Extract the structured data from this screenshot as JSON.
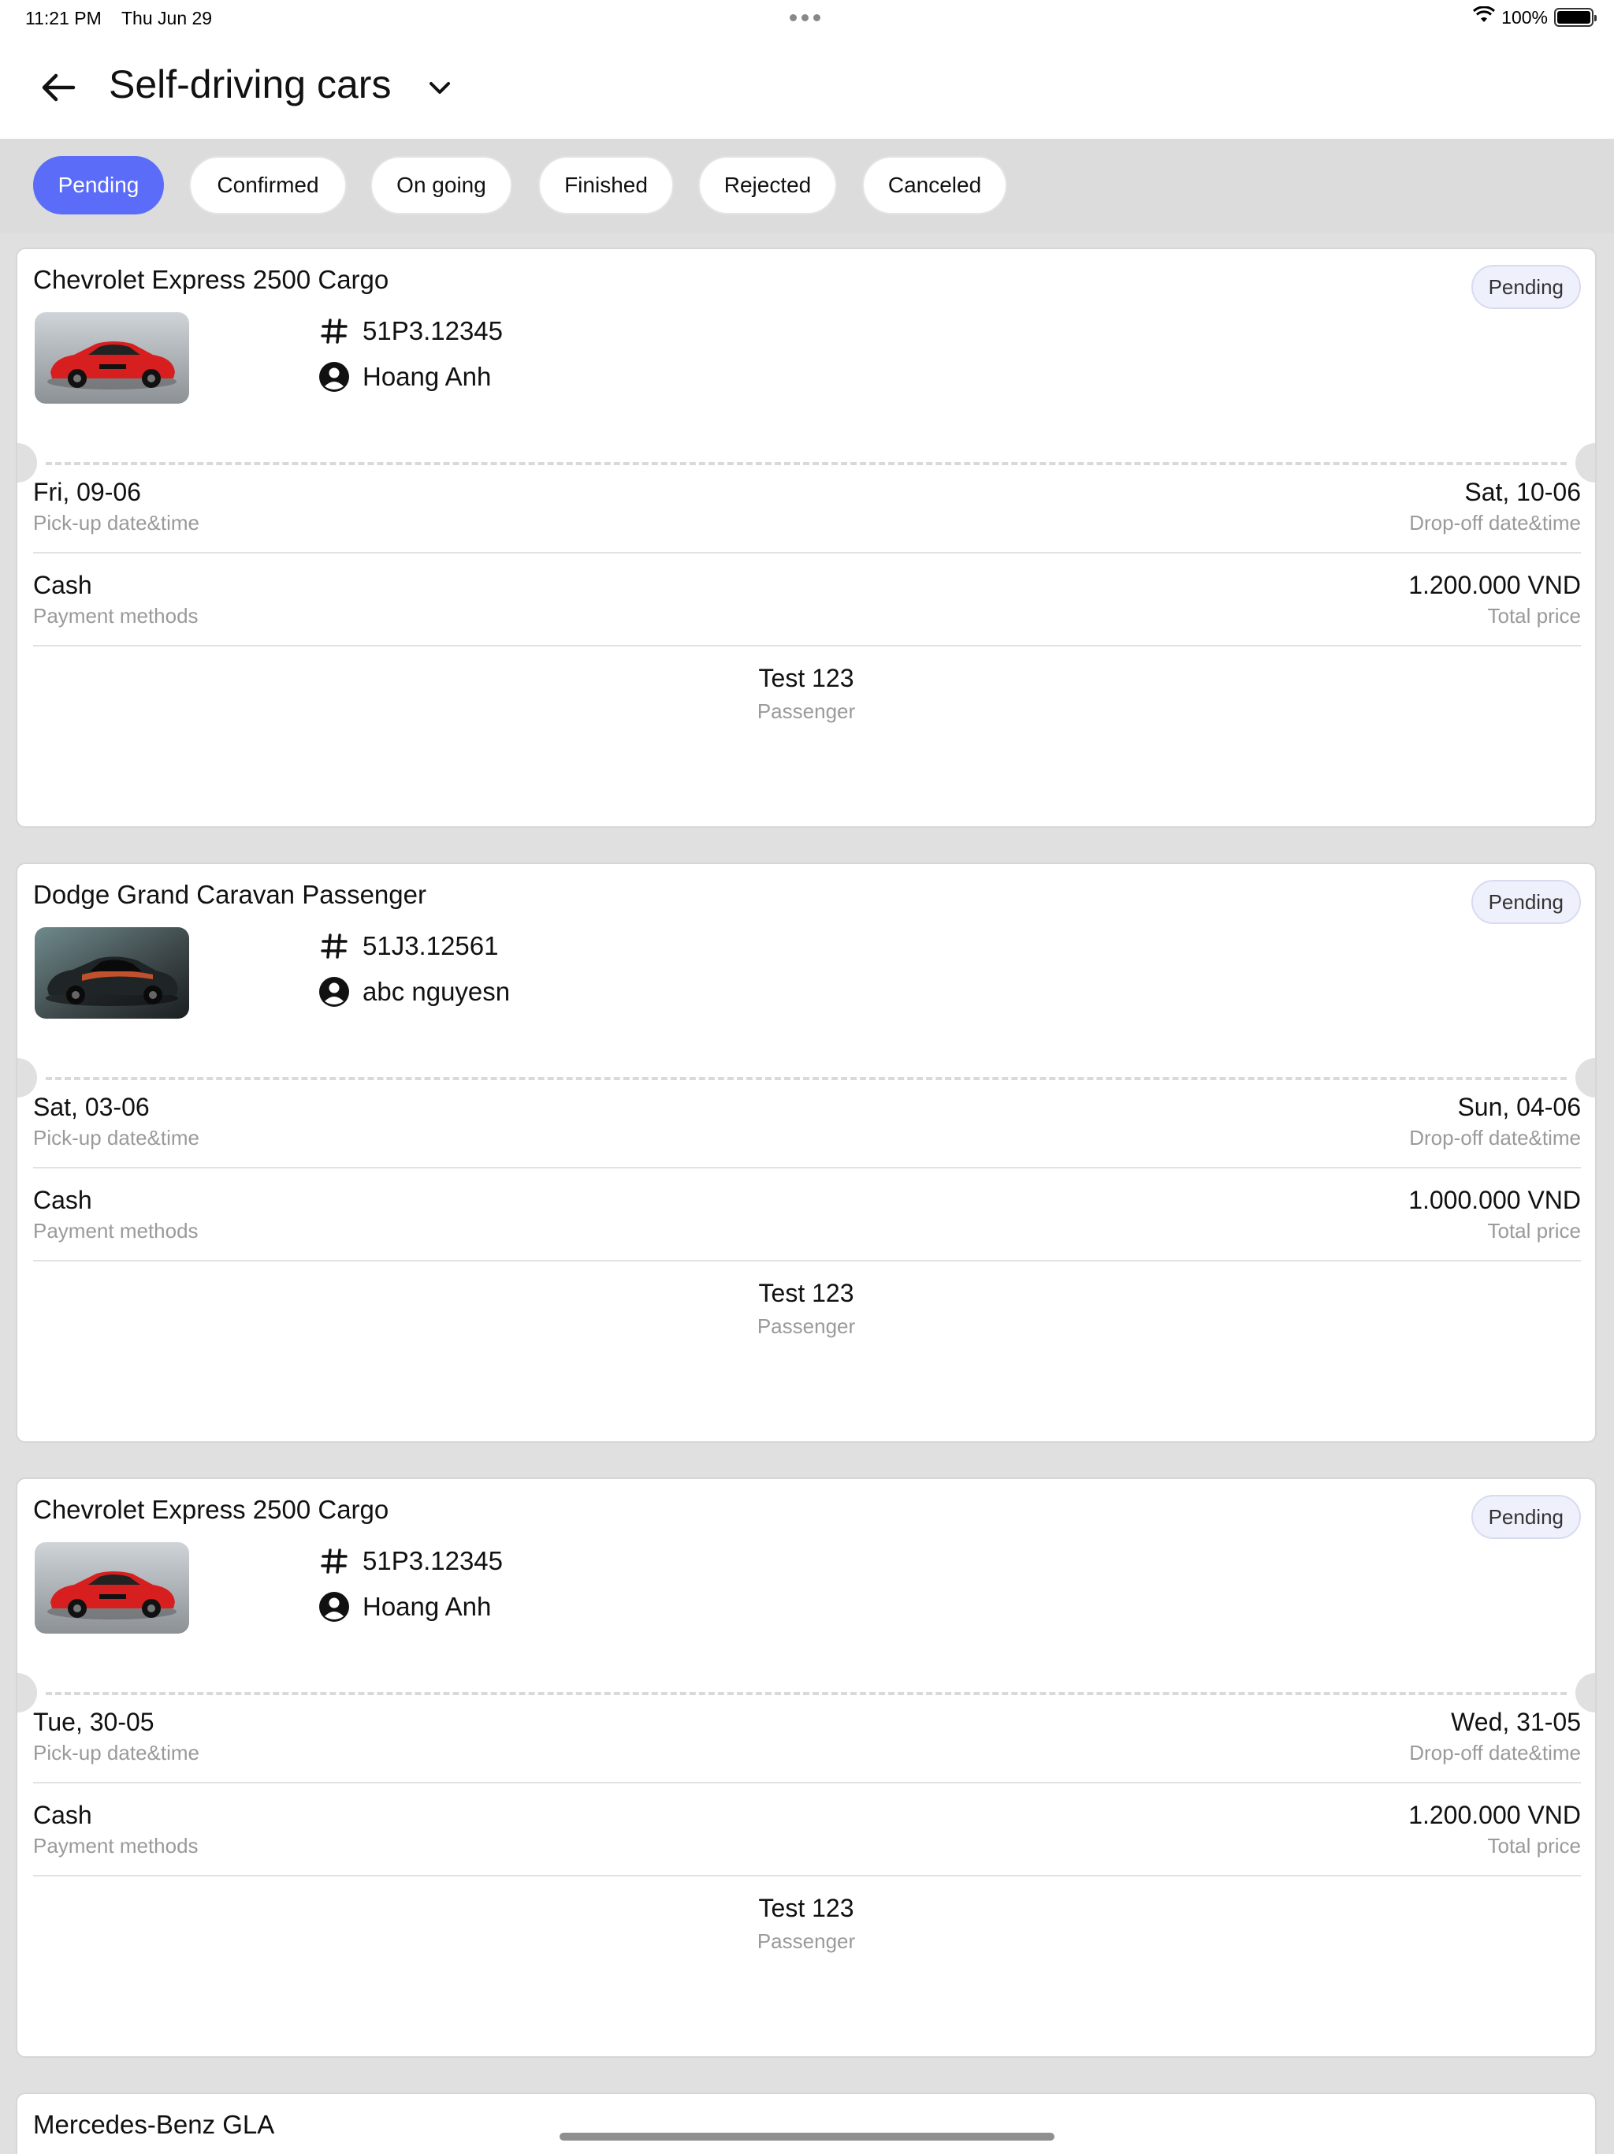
{
  "status_bar": {
    "time": "11:21 PM",
    "date": "Thu Jun 29",
    "battery": "100%"
  },
  "header": {
    "title": "Self-driving cars"
  },
  "tabs": [
    {
      "label": "Pending",
      "active": true
    },
    {
      "label": "Confirmed",
      "active": false
    },
    {
      "label": "On going",
      "active": false
    },
    {
      "label": "Finished",
      "active": false
    },
    {
      "label": "Rejected",
      "active": false
    },
    {
      "label": "Canceled",
      "active": false
    }
  ],
  "labels": {
    "pickup": "Pick-up date&time",
    "dropoff": "Drop-off date&time",
    "payment": "Payment methods",
    "total": "Total price",
    "passenger": "Passenger"
  },
  "bookings": [
    {
      "car_name": "Chevrolet Express 2500 Cargo",
      "status": "Pending",
      "plate": "51P3.12345",
      "owner": "Hoang Anh",
      "pickup_date": "Fri, 09-06",
      "dropoff_date": "Sat, 10-06",
      "payment_method": "Cash",
      "total_price": "1.200.000 VND",
      "passenger": "Test 123",
      "car_color": "red"
    },
    {
      "car_name": "Dodge Grand Caravan Passenger",
      "status": "Pending",
      "plate": "51J3.12561",
      "owner": "abc nguyesn",
      "pickup_date": "Sat, 03-06",
      "dropoff_date": "Sun, 04-06",
      "payment_method": "Cash",
      "total_price": "1.000.000 VND",
      "passenger": "Test 123",
      "car_color": "dark"
    },
    {
      "car_name": "Chevrolet Express 2500 Cargo",
      "status": "Pending",
      "plate": "51P3.12345",
      "owner": "Hoang Anh",
      "pickup_date": "Tue, 30-05",
      "dropoff_date": "Wed, 31-05",
      "payment_method": "Cash",
      "total_price": "1.200.000 VND",
      "passenger": "Test 123",
      "car_color": "red"
    }
  ],
  "partial_booking": {
    "car_name": "Mercedes-Benz GLA"
  },
  "colors": {
    "accent": "#5b6cf9",
    "background": "#e0e0e0",
    "muted_text": "#9a9a9a"
  }
}
